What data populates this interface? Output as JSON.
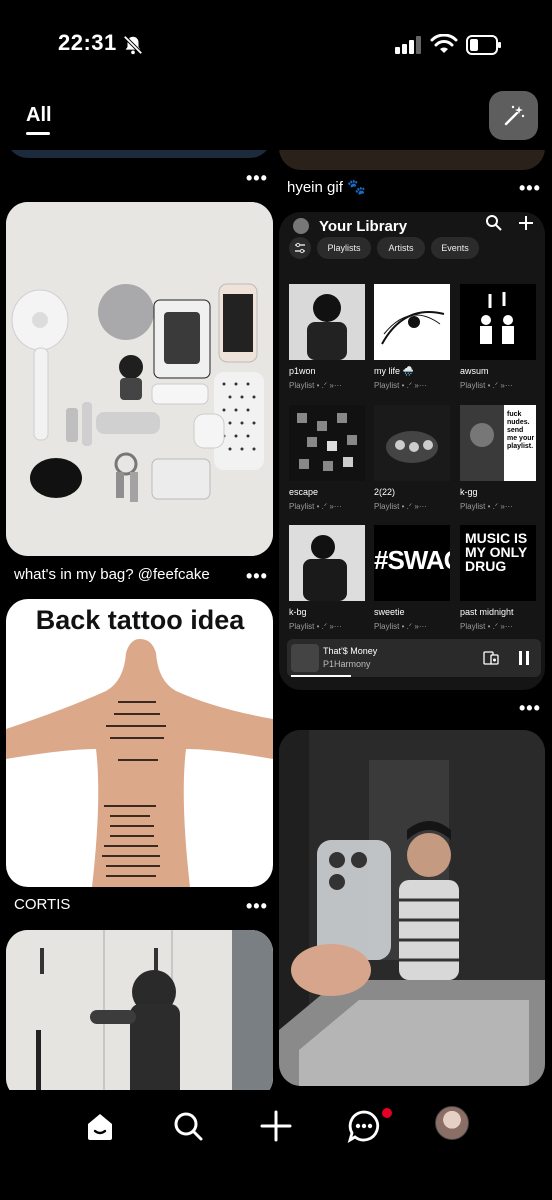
{
  "status": {
    "time": "22:31"
  },
  "tabs": {
    "active": "All"
  },
  "pins": {
    "top_right_caption": "hyein gif 🐾",
    "bag_caption": "what's in my bag? @feefcake",
    "tattoo_title": "Back tattoo idea",
    "tattoo_caption": "CORTIS",
    "more_label": "•••"
  },
  "library": {
    "title": "Your Library",
    "chips": [
      "Playlists",
      "Artists",
      "Events"
    ],
    "tiles": [
      {
        "name": "p1won",
        "sub": "Playlist • .ᐟ »···"
      },
      {
        "name": "my life 🌧️",
        "sub": "Playlist • .ᐟ »···"
      },
      {
        "name": "awsum",
        "sub": "Playlist • .ᐟ »···"
      },
      {
        "name": "escape",
        "sub": "Playlist • .ᐟ »···"
      },
      {
        "name": "2(22)",
        "sub": "Playlist • .ᐟ »···"
      },
      {
        "name": "k-gg",
        "sub": "Playlist • .ᐟ »···"
      },
      {
        "name": "k-bg",
        "sub": "Playlist • .ᐟ »···"
      },
      {
        "name": "sweetie",
        "sub": "Playlist • .ᐟ »···"
      },
      {
        "name": "past midnight",
        "sub": "Playlist • .ᐟ »···"
      }
    ],
    "tile_art_text": {
      "kgg": "fuck nudes. send me your playlist.",
      "swag": "#SWAG",
      "music": "MUSIC IS MY ONLY DRUG"
    },
    "player": {
      "song": "That'$ Money",
      "artist": "P1Harmony"
    }
  },
  "nav": {
    "icons": [
      "home-icon",
      "search-icon",
      "create-icon",
      "messages-icon",
      "profile-avatar"
    ]
  }
}
